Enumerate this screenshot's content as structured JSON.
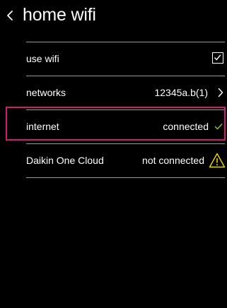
{
  "header": {
    "title": "home wifi",
    "back_icon": "chevron-left-icon"
  },
  "rows": [
    {
      "label": "use wifi",
      "value": "",
      "control": "checkbox",
      "checked": true
    },
    {
      "label": "networks",
      "value": "12345a.b(1)",
      "control": "chevron-right-icon"
    },
    {
      "label": "internet",
      "value": "connected",
      "control": "check-icon",
      "highlighted": true
    },
    {
      "label": "Daikin One Cloud",
      "value": "not connected",
      "control": "warning-icon"
    }
  ],
  "colors": {
    "background": "#000000",
    "text": "#ffffff",
    "divider": "#9a9a9a",
    "highlight": "#cf1c6e",
    "success": "#8ac63f",
    "warning": "#f2d600"
  }
}
